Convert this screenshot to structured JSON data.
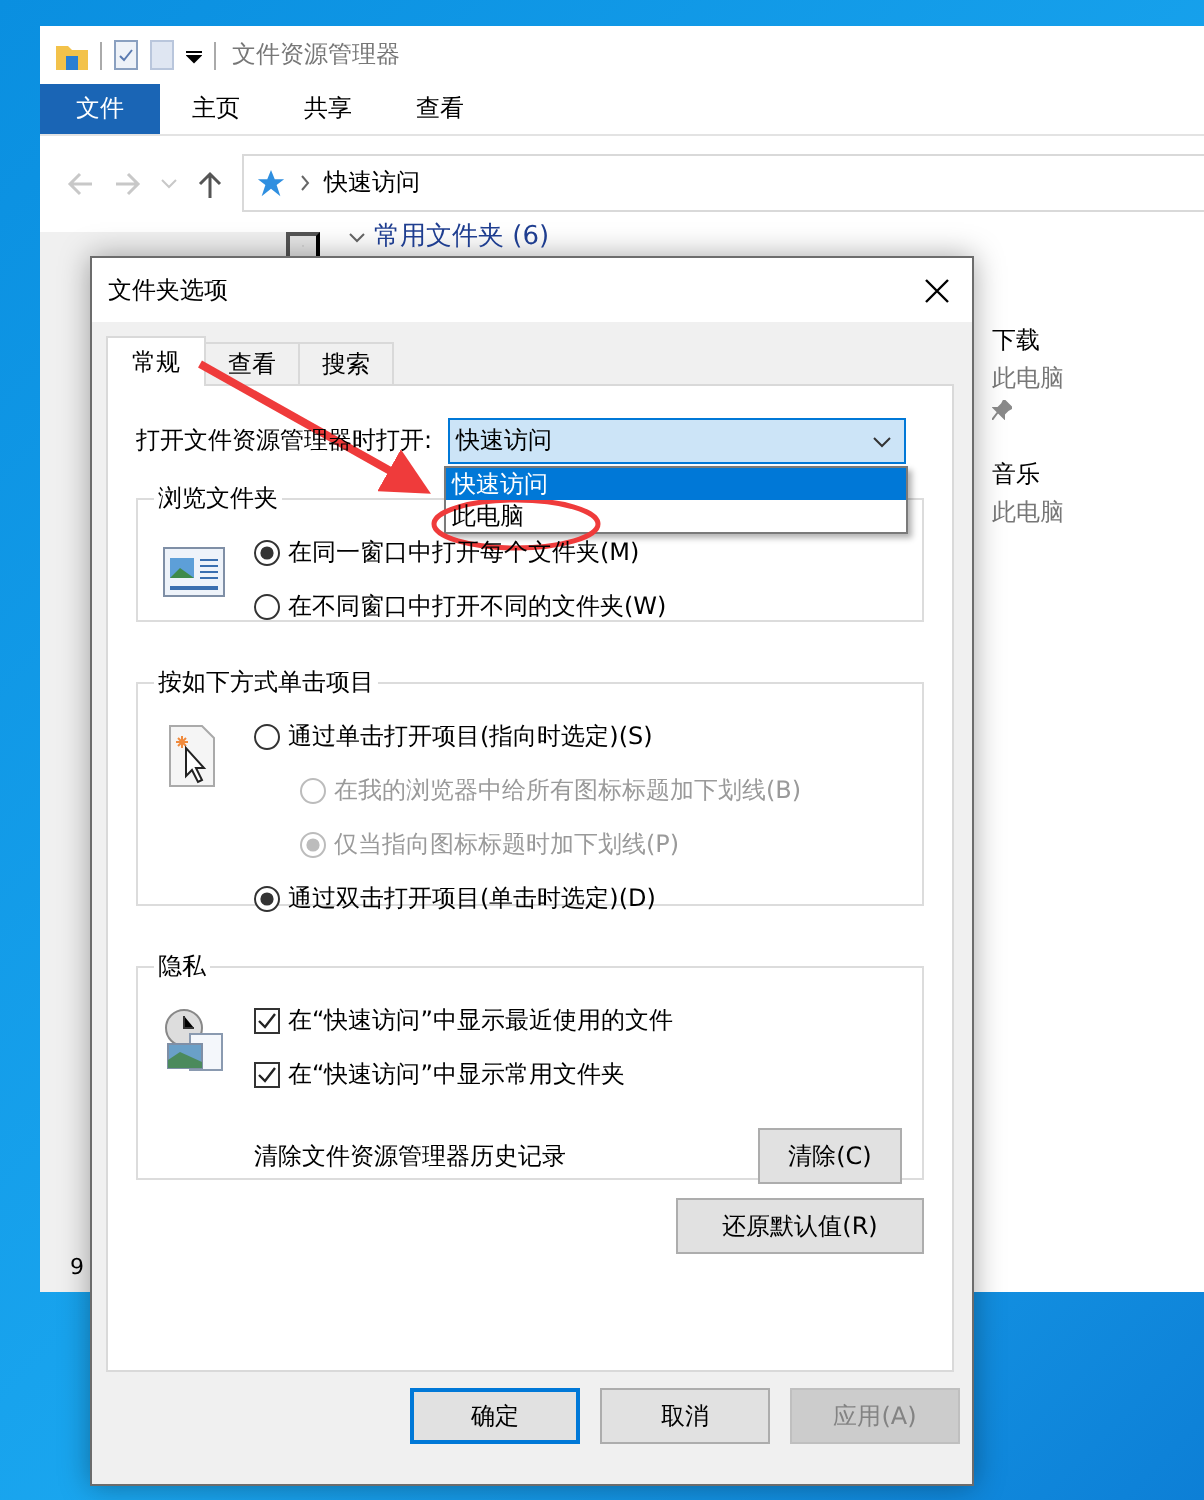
{
  "explorer": {
    "title": "文件资源管理器",
    "ribbon_tabs": [
      {
        "label": "文件",
        "selected": true
      },
      {
        "label": "主页",
        "selected": false
      },
      {
        "label": "共享",
        "selected": false
      },
      {
        "label": "查看",
        "selected": false
      }
    ],
    "breadcrumb": "快速访问",
    "section_header": "常用文件夹 (6)",
    "folders": [
      {
        "name": "下载",
        "location": "此电脑",
        "pinned": true
      },
      {
        "name": "音乐",
        "location": "此电脑",
        "pinned": false
      }
    ],
    "status_count": "9"
  },
  "dialog": {
    "title": "文件夹选项",
    "tabs": [
      {
        "label": "常规",
        "selected": true
      },
      {
        "label": "查看",
        "selected": false
      },
      {
        "label": "搜索",
        "selected": false
      }
    ],
    "open_label": "打开文件资源管理器时打开:",
    "open_combo": {
      "value": "快速访问",
      "expanded": true,
      "options": [
        {
          "label": "快速访问",
          "selected": true
        },
        {
          "label": "此电脑",
          "selected": false
        }
      ]
    },
    "browse_group": {
      "title": "浏览文件夹",
      "options": [
        {
          "label": "在同一窗口中打开每个文件夹(M)",
          "selected": true,
          "disabled": false
        },
        {
          "label": "在不同窗口中打开不同的文件夹(W)",
          "selected": false,
          "disabled": false
        }
      ]
    },
    "click_group": {
      "title": "按如下方式单击项目",
      "options": [
        {
          "label": "通过单击打开项目(指向时选定)(S)",
          "selected": false,
          "disabled": false,
          "children": [
            {
              "label": "在我的浏览器中给所有图标标题加下划线(B)",
              "selected": false,
              "disabled": true
            },
            {
              "label": "仅当指向图标标题时加下划线(P)",
              "selected": true,
              "disabled": true
            }
          ]
        },
        {
          "label": "通过双击打开项目(单击时选定)(D)",
          "selected": true,
          "disabled": false
        }
      ]
    },
    "privacy_group": {
      "title": "隐私",
      "checkboxes": [
        {
          "label": "在“快速访问”中显示最近使用的文件",
          "checked": true
        },
        {
          "label": "在“快速访问”中显示常用文件夹",
          "checked": true
        }
      ],
      "clear_label": "清除文件资源管理器历史记录",
      "clear_button": "清除(C)"
    },
    "restore_button": "还原默认值(R)",
    "buttons": [
      {
        "label": "确定",
        "default": true,
        "disabled": false
      },
      {
        "label": "取消",
        "default": false,
        "disabled": false
      },
      {
        "label": "应用(A)",
        "default": false,
        "disabled": true
      }
    ]
  }
}
